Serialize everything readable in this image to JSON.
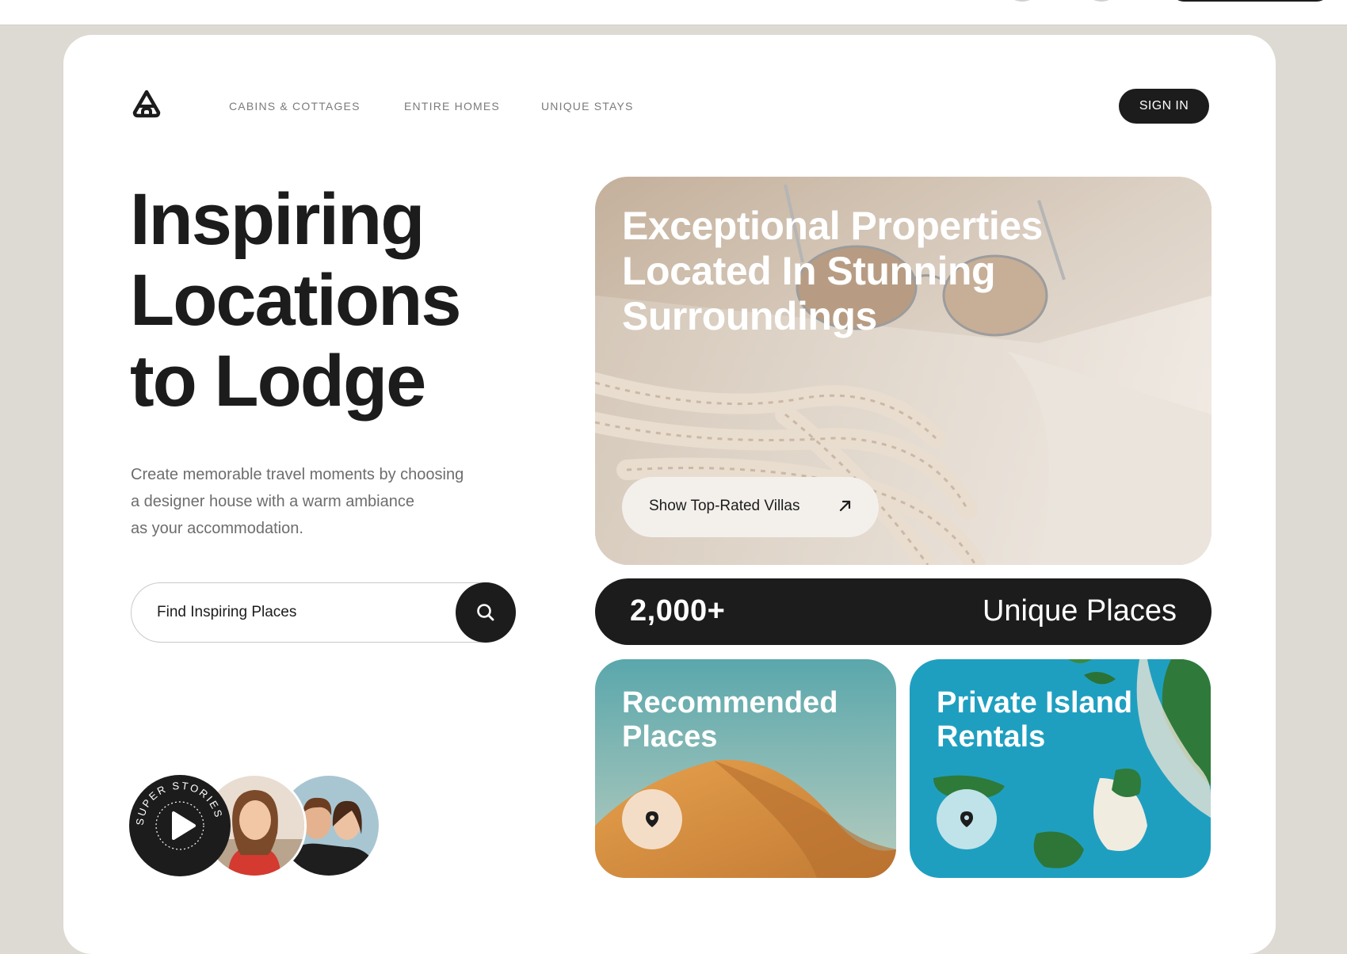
{
  "nav": {
    "items": [
      "CABINS & COTTAGES",
      "ENTIRE HOMES",
      "UNIQUE STAYS"
    ],
    "sign_in": "SIGN IN"
  },
  "hero": {
    "title_lines": [
      "Inspiring",
      "Locations",
      "to Lodge"
    ],
    "description_lines": [
      "Create memorable travel moments by choosing",
      "a designer house with a warm ambiance",
      "as your accommodation."
    ]
  },
  "search": {
    "placeholder": "Find Inspiring Places"
  },
  "stories": {
    "badge_text": "SUPER STORIES"
  },
  "feature": {
    "title_lines": [
      "Exceptional Properties",
      "Located In Stunning",
      "Surroundings"
    ],
    "button_label": "Show Top-Rated Villas"
  },
  "stats": {
    "count": "2,000+",
    "label": "Unique Places"
  },
  "tiles": [
    {
      "title_lines": [
        "Recommended",
        "Places"
      ]
    },
    {
      "title_lines": [
        "Private Island",
        "Rentals"
      ]
    }
  ],
  "icons": {
    "logo": "house-a-logo-icon",
    "search": "search-icon",
    "arrow": "arrow-up-right-icon",
    "pin": "map-pin-icon",
    "play": "play-icon"
  },
  "colors": {
    "dark": "#1c1c1c",
    "page_bg": "#ddd9d3",
    "muted_text": "#6d6d6d"
  }
}
